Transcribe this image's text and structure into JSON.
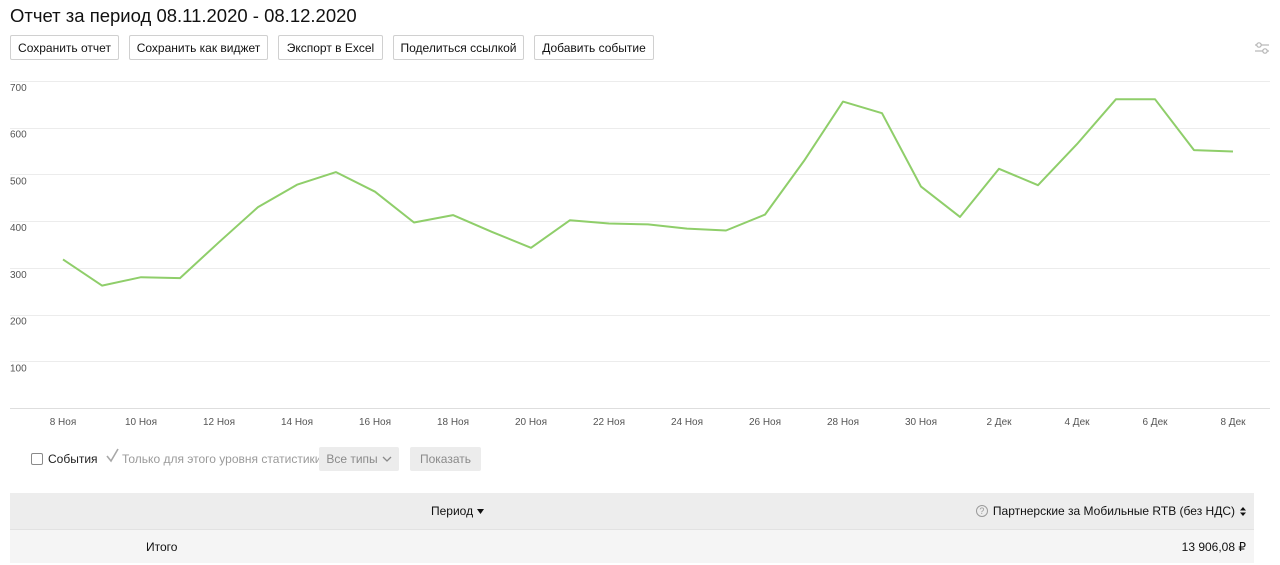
{
  "header": {
    "title": "Отчет за период 08.11.2020 - 08.12.2020"
  },
  "toolbar": {
    "buttons": [
      {
        "label": "Сохранить отчет"
      },
      {
        "label": "Сохранить как виджет"
      },
      {
        "label": "Экспорт в Excel"
      },
      {
        "label": "Поделиться ссылкой"
      },
      {
        "label": "Добавить событие"
      }
    ],
    "settings_icon": "sliders-icon"
  },
  "chart_data": {
    "type": "line",
    "ylim": [
      0,
      700
    ],
    "yticks": [
      100,
      200,
      300,
      400,
      500,
      600,
      700
    ],
    "x_labels": [
      "8 Ноя",
      "10 Ноя",
      "12 Ноя",
      "14 Ноя",
      "16 Ноя",
      "18 Ноя",
      "20 Ноя",
      "22 Ноя",
      "24 Ноя",
      "26 Ноя",
      "28 Ноя",
      "30 Ноя",
      "2 Дек",
      "4 Дек",
      "6 Дек",
      "8 Дек"
    ],
    "x": [
      "8 Ноя",
      "9 Ноя",
      "10 Ноя",
      "11 Ноя",
      "12 Ноя",
      "13 Ноя",
      "14 Ноя",
      "15 Ноя",
      "16 Ноя",
      "17 Ноя",
      "18 Ноя",
      "19 Ноя",
      "20 Ноя",
      "21 Ноя",
      "22 Ноя",
      "23 Ноя",
      "24 Ноя",
      "25 Ноя",
      "26 Ноя",
      "27 Ноя",
      "28 Ноя",
      "29 Ноя",
      "30 Ноя",
      "1 Дек",
      "2 Дек",
      "3 Дек",
      "4 Дек",
      "5 Дек",
      "6 Дек",
      "7 Дек",
      "8 Дек"
    ],
    "series": [
      {
        "values": [
          318,
          262,
          280,
          278,
          355,
          430,
          478,
          505,
          463,
          397,
          413,
          377,
          343,
          402,
          395,
          393,
          384,
          380,
          414,
          529,
          656,
          631,
          474,
          409,
          512,
          477,
          565,
          661,
          661,
          552,
          549
        ],
        "color": "#8fce6a"
      }
    ],
    "grid": true,
    "legend": "none"
  },
  "filters": {
    "events_label": "События",
    "only_level_label": "Только для этого уровня статистики",
    "types_label": "Все типы",
    "show_label": "Показать"
  },
  "table": {
    "columns": [
      "Период",
      "Партнерские за Мобильные RTB (без НДС)"
    ],
    "rows": [
      {
        "label": "Итого",
        "value": "13 906,08 ₽"
      }
    ]
  }
}
